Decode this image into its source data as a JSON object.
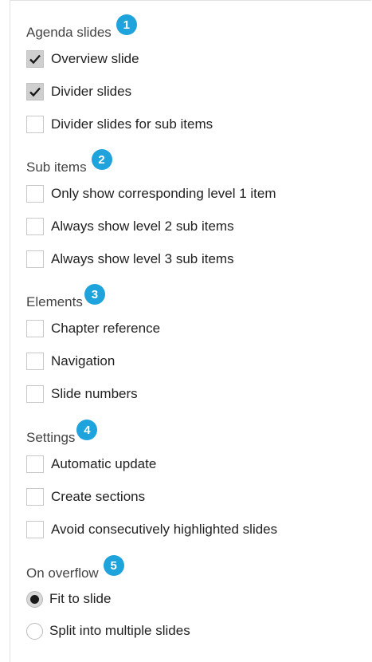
{
  "groups": [
    {
      "title": "Agenda slides",
      "badge": "1",
      "options": [
        {
          "label": "Overview slide",
          "checked": true
        },
        {
          "label": "Divider slides",
          "checked": true
        },
        {
          "label": "Divider slides for sub items",
          "checked": false
        }
      ]
    },
    {
      "title": "Sub items",
      "badge": "2",
      "options": [
        {
          "label": "Only show corresponding level 1 item",
          "checked": false
        },
        {
          "label": "Always show level 2 sub items",
          "checked": false
        },
        {
          "label": "Always show level 3 sub items",
          "checked": false
        }
      ]
    },
    {
      "title": "Elements",
      "badge": "3",
      "options": [
        {
          "label": "Chapter reference",
          "checked": false
        },
        {
          "label": "Navigation",
          "checked": false
        },
        {
          "label": "Slide numbers",
          "checked": false
        }
      ]
    },
    {
      "title": "Settings",
      "badge": "4",
      "options": [
        {
          "label": "Automatic update",
          "checked": false
        },
        {
          "label": "Create sections",
          "checked": false
        },
        {
          "label": "Avoid consecutively highlighted slides",
          "checked": false
        }
      ]
    },
    {
      "title": "On overflow",
      "badge": "5",
      "radios": [
        {
          "label": "Fit to slide",
          "selected": true
        },
        {
          "label": "Split into multiple slides",
          "selected": false
        }
      ]
    }
  ],
  "colors": {
    "badge": "#1fa3dd",
    "check_fill": "#cfcfcf",
    "checkmark": "#1a1a1a"
  },
  "icons": {
    "badge": "numbered-circle-badge",
    "check": "checkmark-icon",
    "radio": "radio-dot-icon"
  }
}
